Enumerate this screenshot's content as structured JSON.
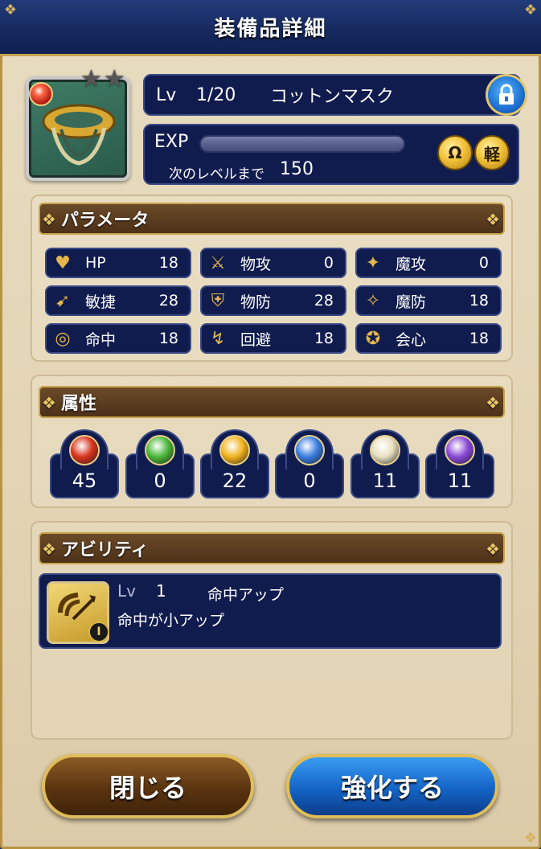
{
  "header": {
    "title": "装備品詳細"
  },
  "item": {
    "rarity_stars": 2,
    "lv_label": "Lv",
    "level": "1/20",
    "name": "コットンマスク",
    "exp_label": "EXP",
    "exp_progress": 0,
    "next_label": "次のレベルまで",
    "next_value": "150",
    "buttons": {
      "type_badge": "Ω",
      "weight_badge": "軽"
    }
  },
  "parameters": {
    "title": "パラメータ",
    "stats": [
      {
        "icon": "heart-icon",
        "label": "HP",
        "value": "18"
      },
      {
        "icon": "sword-icon",
        "label": "物攻",
        "value": "0"
      },
      {
        "icon": "magic-staff-icon",
        "label": "魔攻",
        "value": "0"
      },
      {
        "icon": "speed-icon",
        "label": "敏捷",
        "value": "28"
      },
      {
        "icon": "shield-icon",
        "label": "物防",
        "value": "28"
      },
      {
        "icon": "magic-defense-icon",
        "label": "魔防",
        "value": "18"
      },
      {
        "icon": "target-icon",
        "label": "命中",
        "value": "18"
      },
      {
        "icon": "evade-icon",
        "label": "回避",
        "value": "18"
      },
      {
        "icon": "critical-icon",
        "label": "会心",
        "value": "18"
      }
    ]
  },
  "attributes": {
    "title": "属性",
    "items": [
      {
        "icon": "fire-orb-icon",
        "color": "#d8341e",
        "value": "45"
      },
      {
        "icon": "wind-orb-icon",
        "color": "#4cb83a",
        "value": "0"
      },
      {
        "icon": "light-orb-icon",
        "color": "#f2b41e",
        "value": "22"
      },
      {
        "icon": "ice-orb-icon",
        "color": "#3a7ce0",
        "value": "0"
      },
      {
        "icon": "holy-orb-icon",
        "color": "#e8e0c0",
        "value": "11"
      },
      {
        "icon": "dark-orb-icon",
        "color": "#8a4ad8",
        "value": "11"
      }
    ]
  },
  "ability": {
    "title": "アビリティ",
    "lv_label": "Lv",
    "level": "1",
    "name": "命中アップ",
    "description": "命中が小アップ",
    "badge": "I"
  },
  "footer": {
    "close_label": "閉じる",
    "enhance_label": "強化する"
  }
}
